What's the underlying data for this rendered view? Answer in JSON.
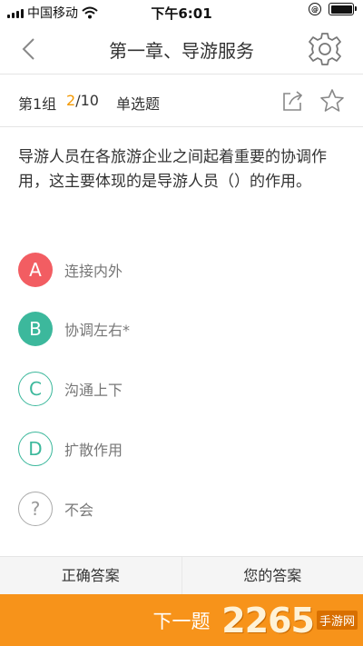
{
  "status_bar": {
    "carrier": "中国移动",
    "time": "下午6:01",
    "orientation_lock": "@"
  },
  "nav": {
    "title": "第一章、导游服务",
    "back_icon": "chevron-left-icon",
    "settings_icon": "gear-icon"
  },
  "info": {
    "group": "第1组",
    "current": "2",
    "total": "/10",
    "type": "单选题",
    "share_icon": "share-icon",
    "star_icon": "star-icon"
  },
  "question": {
    "text": "导游人员在各旅游企业之间起着重要的协调作用，这主要体现的是导游人员（）的作用。"
  },
  "options": [
    {
      "letter": "A",
      "text": "连接内外",
      "state": "wrong"
    },
    {
      "letter": "B",
      "text": "协调左右*",
      "state": "correct"
    },
    {
      "letter": "C",
      "text": "沟通上下",
      "state": "plain"
    },
    {
      "letter": "D",
      "text": "扩散作用",
      "state": "plain"
    },
    {
      "letter": "?",
      "text": "不会",
      "state": "unknown"
    }
  ],
  "answer_tabs": {
    "correct": "正确答案",
    "yours": "您的答案"
  },
  "next": {
    "label": "下一题"
  },
  "watermark": {
    "number": "2265",
    "text": "手游网"
  },
  "colors": {
    "accent_orange": "#f7931a",
    "progress_orange": "#f39800",
    "correct_green": "#3cb89c",
    "wrong_red": "#f25d62"
  }
}
